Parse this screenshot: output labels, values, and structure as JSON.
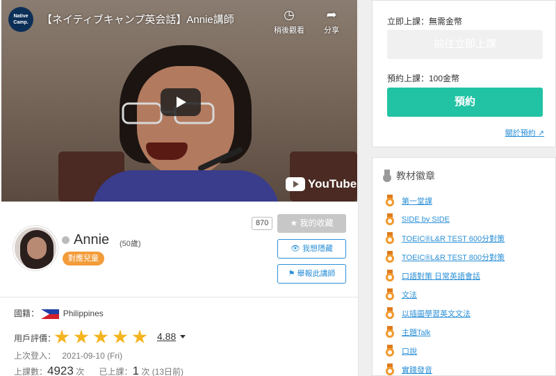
{
  "video": {
    "title": "【ネイティブキャンプ英会話】Annie講師",
    "logo_text": "Native Camp.",
    "watch_later": "稍後觀看",
    "share": "分享",
    "brand": "YouTube"
  },
  "teacher": {
    "name": "Annie",
    "age": "(50歲)",
    "kids_badge": "對應兒童",
    "fav_count": "870",
    "fav_button": "我的收藏",
    "hide_button": "我想隱藏",
    "report_button": "舉報此講師",
    "nationality_label": "國籍：",
    "nationality": "Philippines",
    "rating_label": "用戶評價：",
    "rating": "4.88",
    "last_login_label": "上次登入：",
    "last_login": "2021-09-10 (Fri)",
    "lessons_label": "上課數：",
    "lessons_count": "4923",
    "lessons_unit": "次",
    "taken_label": "已上課：",
    "taken_count": "1",
    "taken_unit": "次 (13日前)"
  },
  "booking": {
    "instant_label": "立即上課：無需金幣",
    "instant_button": "前往立即上課",
    "reserve_label": "預約上課：100金幣",
    "reserve_button": "預約",
    "about_link": "關於預約"
  },
  "materials": {
    "title": "教材徽章",
    "items": [
      "第一堂課",
      "SIDE by SIDE",
      "TOEIC®L&R TEST 600分對策",
      "TOEIC®L&R TEST 800分對策",
      "口語對策 日常英語會話",
      "文法",
      "以插圖學習英文文法",
      "主題Talk",
      "口說",
      "實踐發音"
    ]
  },
  "colors": {
    "accent_green": "#21c3a4",
    "link_blue": "#2a8fd6",
    "kids_orange": "#f39c3a",
    "star_gold": "#f5b41e"
  }
}
